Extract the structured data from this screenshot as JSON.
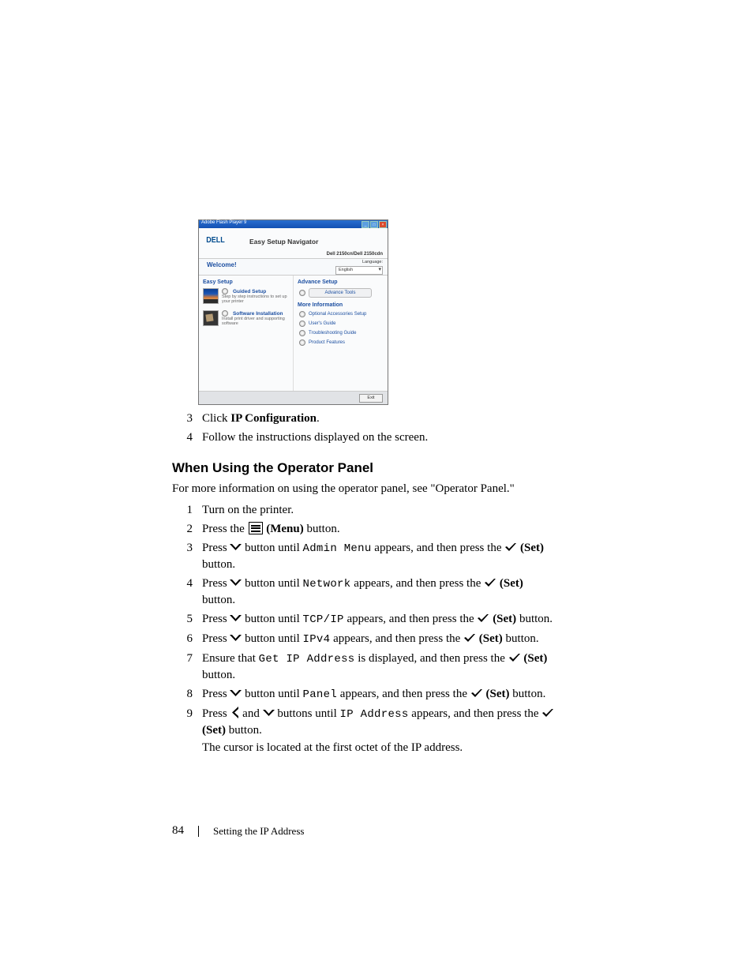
{
  "windowTitle": "Adobe Flash Player 9",
  "shot": {
    "logo": "DELL",
    "headerTitle": "Easy Setup Navigator",
    "model": "Dell 2150cn/Dell 2150cdn",
    "welcome": "Welcome!",
    "langLabel": "Language:",
    "langValue": "English",
    "leftHead": "Easy Setup",
    "card1t": "Guided Setup",
    "card1d": "Step by step instructions to set up your printer",
    "card2t": "Software Installation",
    "card2d": "Install print driver and supporting software",
    "rightHead": "Advance Setup",
    "pill1": "Advance Tools",
    "moreHead": "More Information",
    "link1": "Optional Accessories Setup",
    "link2": "User's Guide",
    "link3": "Troubleshooting Guide",
    "link4": "Product Features",
    "exit": "Exit"
  },
  "step3": {
    "n": "3",
    "a": "Click ",
    "b": "IP Configuration",
    "c": "."
  },
  "step4": {
    "n": "4",
    "t": "Follow the instructions displayed on the screen."
  },
  "secHead": "When Using the Operator Panel",
  "para1": "For more information on using the operator panel, see \"Operator Panel.\"",
  "op": {
    "s1": {
      "n": "1",
      "t": "Turn on the printer."
    },
    "s2": {
      "n": "2",
      "a": "Press the ",
      "b": " (Menu)",
      "c": " button."
    },
    "s3": {
      "n": "3",
      "a": "Press ",
      "b": " button until ",
      "code": "Admin Menu",
      "c": " appears, and then press the ",
      "d": " (Set)",
      "e": "button."
    },
    "s4": {
      "n": "4",
      "a": "Press ",
      "b": " button until ",
      "code": "Network",
      "c": " appears, and then press the ",
      "d": " (Set)",
      "e": "button."
    },
    "s5": {
      "n": "5",
      "a": "Press ",
      "b": " button until ",
      "code": "TCP/IP",
      "c": " appears, and then press the ",
      "d": " (Set)",
      "e": " button."
    },
    "s6": {
      "n": "6",
      "a": "Press ",
      "b": " button until ",
      "code": "IPv4",
      "c": " appears, and then press the ",
      "d": " (Set)",
      "e": " button."
    },
    "s7": {
      "n": "7",
      "a": "Ensure that ",
      "code": "Get IP Address",
      "c": " is displayed, and then press the ",
      "d": " (Set)",
      "e": "button."
    },
    "s8": {
      "n": "8",
      "a": "Press ",
      "b": " button until ",
      "code": "Panel",
      "c": " appears, and then press the ",
      "d": " (Set)",
      "e": " button."
    },
    "s9": {
      "n": "9",
      "a": "Press ",
      "b": " and ",
      "c": " buttons until ",
      "code": "IP Address",
      "d": " appears, and then press the ",
      "e": "(Set)",
      "f": " button."
    },
    "s9p2": "The cursor is located at the first octet of the IP address."
  },
  "foot": {
    "page": "84",
    "title": "Setting the IP Address"
  }
}
